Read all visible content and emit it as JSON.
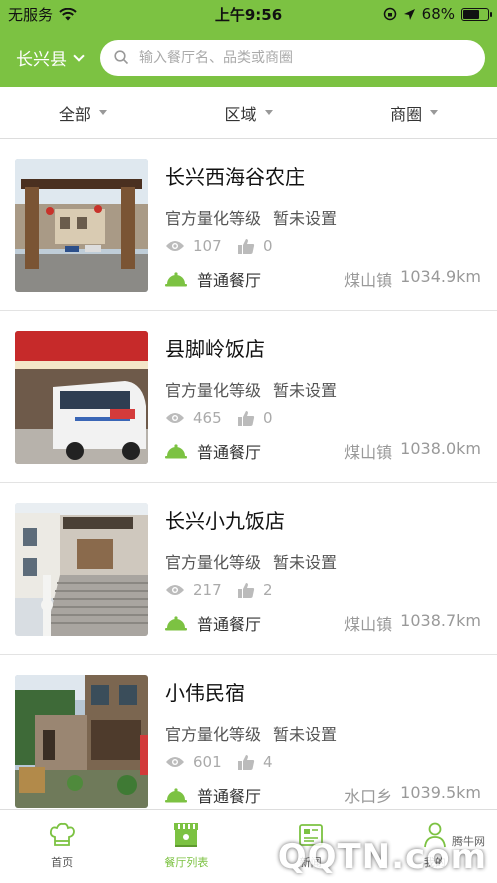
{
  "status_bar": {
    "carrier": "无服务",
    "time": "上午9:56",
    "battery": "68%",
    "battery_level": 0.68
  },
  "header": {
    "city": "长兴县",
    "search_placeholder": "输入餐厅名、品类或商圈"
  },
  "filters": [
    {
      "label": "全部"
    },
    {
      "label": "区域"
    },
    {
      "label": "商圈"
    }
  ],
  "restaurants": [
    {
      "name": "长兴西海谷农庄",
      "grade_label": "官方量化等级",
      "grade_value": "暂未设置",
      "views": "107",
      "likes": "0",
      "type": "普通餐厅",
      "town": "煤山镇",
      "distance": "1034.9km",
      "thumb_icon": "farm-gate-photo"
    },
    {
      "name": "县脚岭饭店",
      "grade_label": "官方量化等级",
      "grade_value": "暂未设置",
      "views": "465",
      "likes": "0",
      "type": "普通餐厅",
      "town": "煤山镇",
      "distance": "1038.0km",
      "thumb_icon": "restaurant-van-photo"
    },
    {
      "name": "长兴小九饭店",
      "grade_label": "官方量化等级",
      "grade_value": "暂未设置",
      "views": "217",
      "likes": "2",
      "type": "普通餐厅",
      "town": "煤山镇",
      "distance": "1038.7km",
      "thumb_icon": "building-stairs-photo"
    },
    {
      "name": "小伟民宿",
      "grade_label": "官方量化等级",
      "grade_value": "暂未设置",
      "views": "601",
      "likes": "4",
      "type": "普通餐厅",
      "town": "水口乡",
      "distance": "1039.5km",
      "thumb_icon": "guesthouse-photo"
    }
  ],
  "tabbar": [
    {
      "label": "首页",
      "icon": "chef-hat-icon",
      "active": false
    },
    {
      "label": "餐厅列表",
      "icon": "storefront-icon",
      "active": true
    },
    {
      "label": "新闻",
      "icon": "news-icon",
      "active": false
    },
    {
      "label": "我的",
      "icon": "user-icon",
      "active": false
    }
  ],
  "watermark": {
    "text": "QQTN.com",
    "small": "腾牛网"
  },
  "colors": {
    "brand_green": "#7cc242",
    "text_dark": "#111111",
    "text_gray": "#999999"
  }
}
